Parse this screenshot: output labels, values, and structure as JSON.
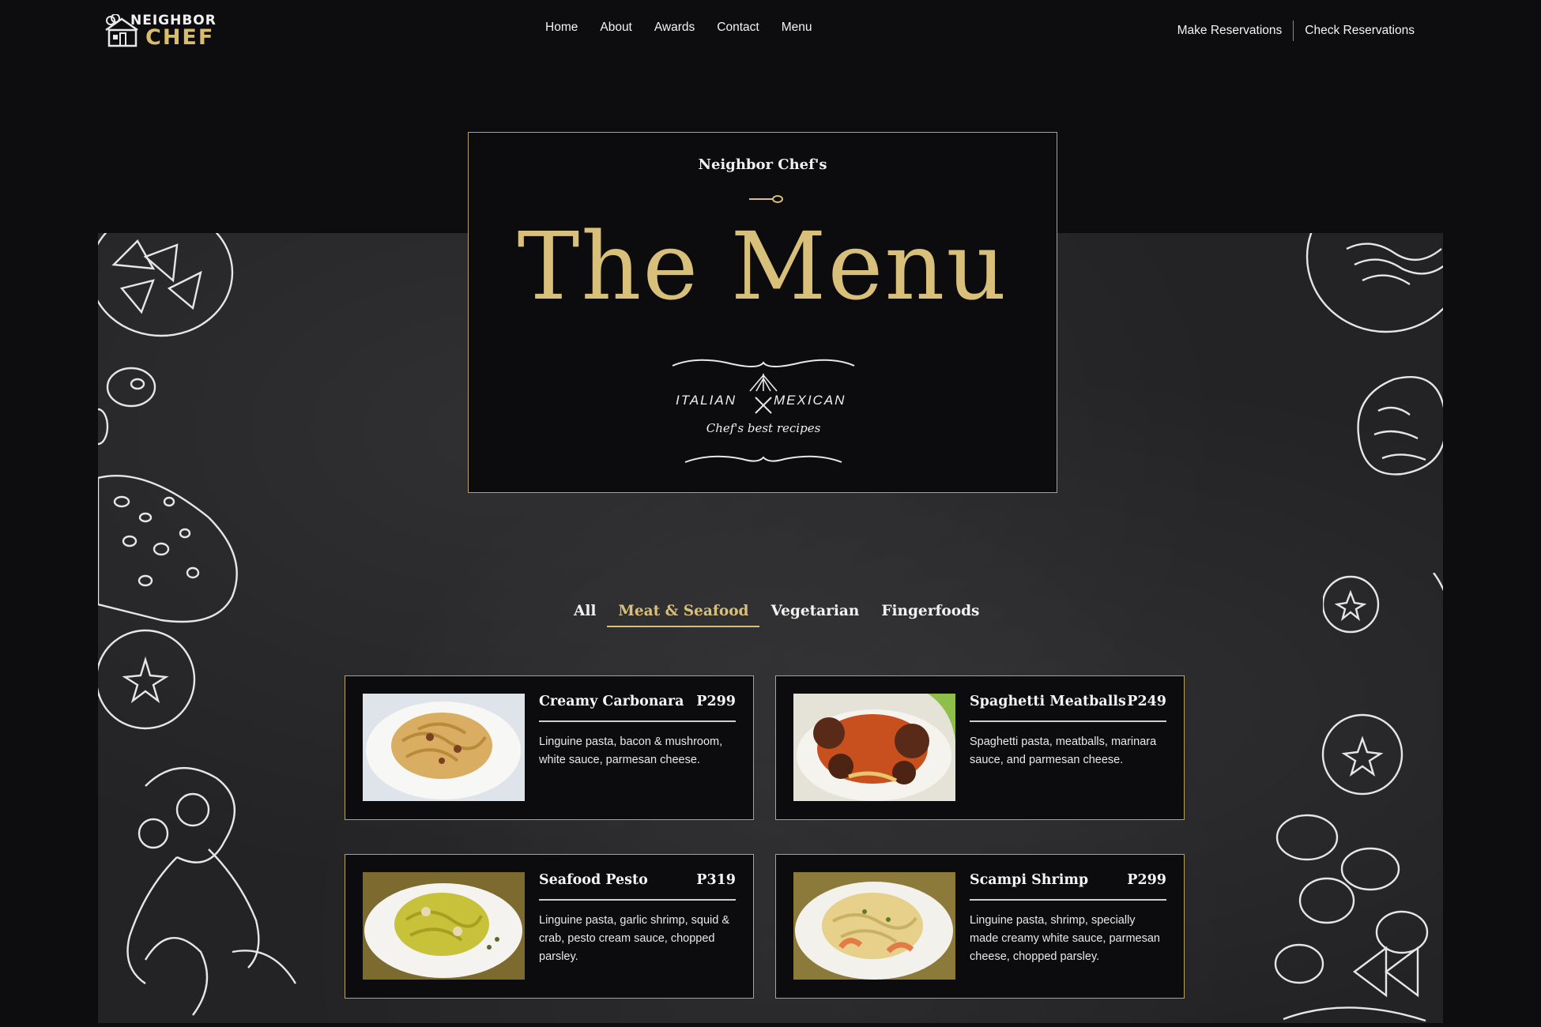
{
  "brand": {
    "top": "NEIGHBOR",
    "bottom": "CHEF"
  },
  "nav": {
    "home": "Home",
    "about": "About",
    "awards": "Awards",
    "contact": "Contact",
    "menu": "Menu"
  },
  "reservations": {
    "make": "Make Reservations",
    "check": "Check Reservations"
  },
  "hero": {
    "kicker": "Neighbor Chef's",
    "title": "The Menu",
    "cuisine_left": "ITALIAN",
    "cuisine_right": "MEXICAN",
    "tagline": "Chef's best recipes"
  },
  "tabs": [
    {
      "label": "All",
      "active": false
    },
    {
      "label": "Meat & Seafood",
      "active": true
    },
    {
      "label": "Vegetarian",
      "active": false
    },
    {
      "label": "Fingerfoods",
      "active": false
    }
  ],
  "items": [
    {
      "name": "Creamy Carbonara",
      "price": "P299",
      "desc": "Linguine pasta, bacon & mushroom, white sauce, parmesan cheese."
    },
    {
      "name": "Spaghetti Meatballs",
      "price": "P249",
      "desc": "Spaghetti pasta, meatballs, marinara sauce, and parmesan cheese."
    },
    {
      "name": "Seafood Pesto",
      "price": "P319",
      "desc": "Linguine pasta, garlic shrimp, squid & crab, pesto cream sauce, chopped parsley."
    },
    {
      "name": "Scampi Shrimp",
      "price": "P299",
      "desc": "Linguine pasta, shrimp, specially made creamy white sauce, parmesan cheese, chopped parsley."
    }
  ],
  "colors": {
    "gold": "#d8c07a",
    "border": "#b9a263",
    "panel": "#0c0c0e",
    "board": "#232325"
  }
}
